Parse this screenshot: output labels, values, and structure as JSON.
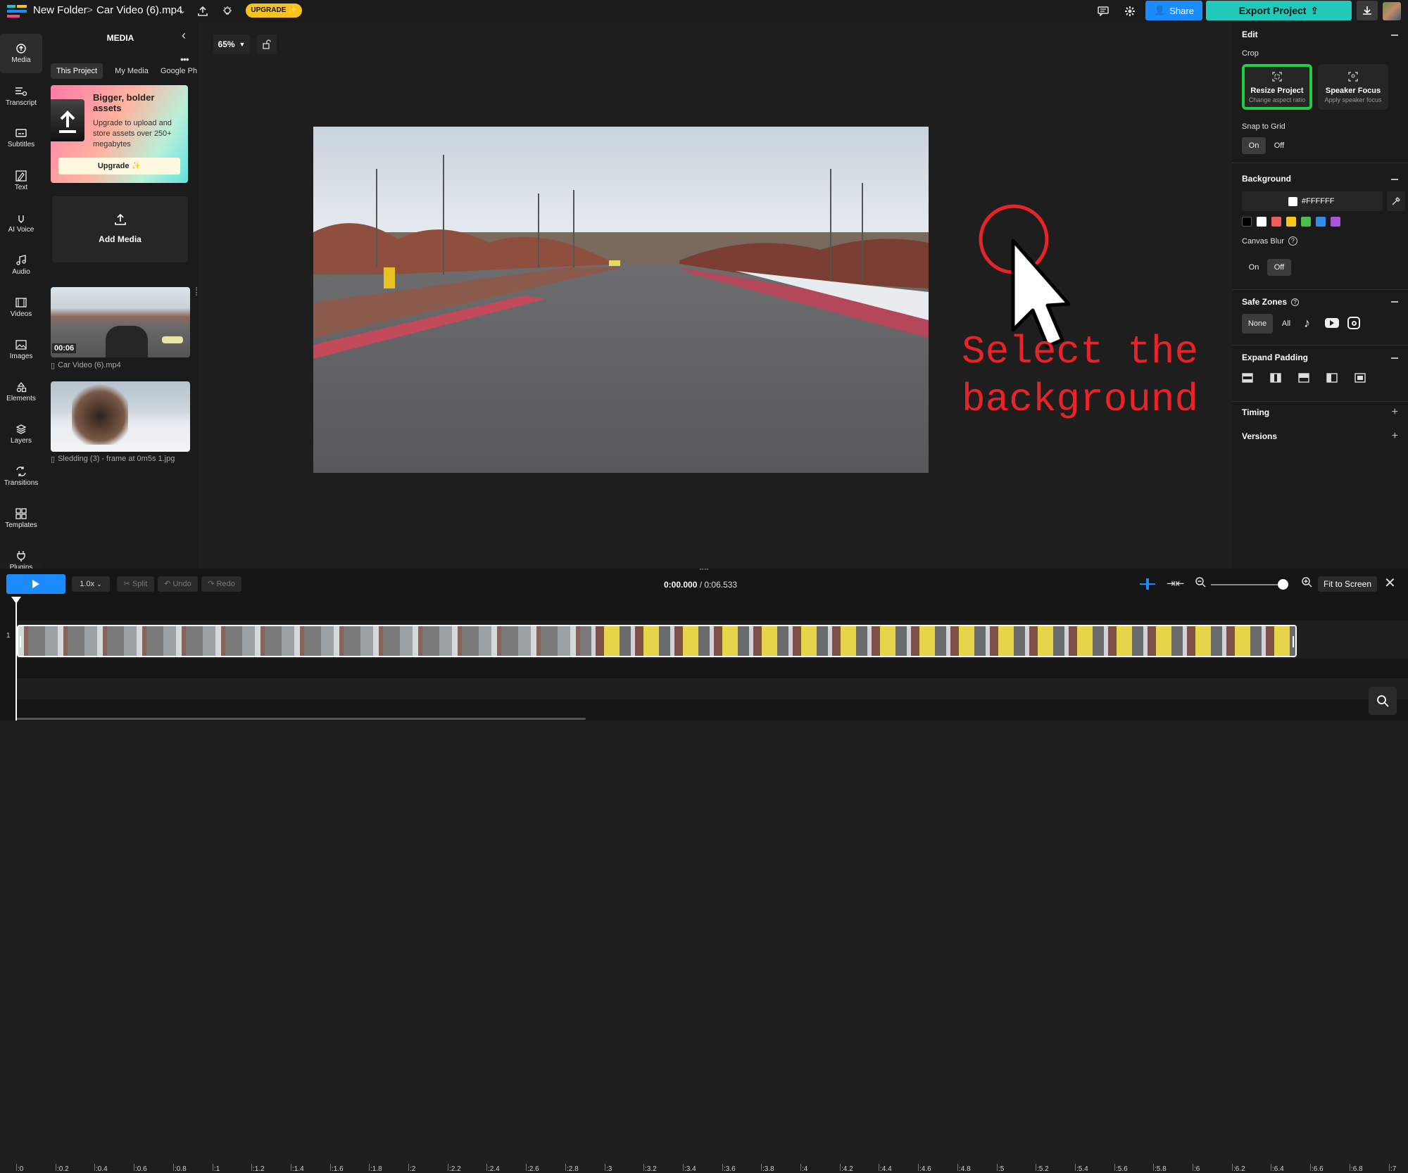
{
  "topbar": {
    "breadcrumb_folder": "New Folder",
    "breadcrumb_sep": ">",
    "project_name": "Car Video (6).mp4",
    "upgrade_label": "UPGRADE ✨",
    "share_label": "Share",
    "export_label": "Export Project"
  },
  "rail": {
    "items": [
      {
        "label": "Media",
        "icon": "media-icon"
      },
      {
        "label": "Transcript",
        "icon": "transcript-icon"
      },
      {
        "label": "Subtitles",
        "icon": "subtitles-icon"
      },
      {
        "label": "Text",
        "icon": "text-icon"
      },
      {
        "label": "AI Voice",
        "icon": "ai-voice-icon"
      },
      {
        "label": "Audio",
        "icon": "audio-icon"
      },
      {
        "label": "Videos",
        "icon": "videos-icon"
      },
      {
        "label": "Images",
        "icon": "images-icon"
      },
      {
        "label": "Elements",
        "icon": "elements-icon"
      },
      {
        "label": "Layers",
        "icon": "layers-icon"
      },
      {
        "label": "Transitions",
        "icon": "transitions-icon"
      },
      {
        "label": "Templates",
        "icon": "templates-icon"
      },
      {
        "label": "Plugins",
        "icon": "plugins-icon"
      }
    ]
  },
  "media": {
    "title": "MEDIA",
    "tabs": [
      "This Project",
      "My Media",
      "Google Ph"
    ],
    "promo": {
      "heading": "Bigger, bolder assets",
      "body": "Upgrade to upload and store assets over 250+ megabytes",
      "button": "Upgrade ✨"
    },
    "add_media": "Add Media",
    "files": [
      {
        "name": "Car Video (6).mp4",
        "duration": "00:06"
      },
      {
        "name": "Sledding (3) - frame at 0m5s 1.jpg",
        "duration": ""
      }
    ]
  },
  "stage": {
    "zoom": "65%",
    "annotation_line1": "Select the",
    "annotation_line2": "background"
  },
  "right": {
    "edit": "Edit",
    "crop": "Crop",
    "resize_title": "Resize Project",
    "resize_sub": "Change aspect ratio",
    "speaker_title": "Speaker Focus",
    "speaker_sub": "Apply speaker focus",
    "snap": "Snap to Grid",
    "on": "On",
    "off": "Off",
    "background": "Background",
    "bg_hex": "#FFFFFF",
    "swatches": [
      "#000000",
      "#ffffff",
      "#f05a5a",
      "#f5c518",
      "#4cbb4c",
      "#2f8fe8",
      "#a855d8"
    ],
    "canvas_blur": "Canvas Blur",
    "safe_zones": "Safe Zones",
    "none": "None",
    "all": "All",
    "expand_padding": "Expand Padding",
    "timing": "Timing",
    "versions": "Versions"
  },
  "timeline": {
    "speed": "1.0x",
    "split": "Split",
    "undo": "Undo",
    "redo": "Redo",
    "current_time": "0:00.000",
    "total_time": "/ 0:06.533",
    "fit": "Fit to Screen",
    "track_number": "1",
    "ticks": [
      ":0",
      ":0.2",
      ":0.4",
      ":0.6",
      ":0.8",
      ":1",
      ":1.2",
      ":1.4",
      ":1.6",
      ":1.8",
      ":2",
      ":2.2",
      ":2.4",
      ":2.6",
      ":2.8",
      ":3",
      ":3.2",
      ":3.4",
      ":3.6",
      ":3.8",
      ":4",
      ":4.2",
      ":4.4",
      ":4.6",
      ":4.8",
      ":5",
      ":5.2",
      ":5.4",
      ":5.6",
      ":5.8",
      ":6",
      ":6.2",
      ":6.4",
      ":6.6",
      ":6.8",
      ":7"
    ]
  },
  "colors": {
    "accent_blue": "#1a8cff",
    "export_teal": "#20c9b9",
    "upgrade_yellow": "#f7c21c",
    "highlight_green": "#22cc44",
    "annotation_red": "#e8232a"
  }
}
